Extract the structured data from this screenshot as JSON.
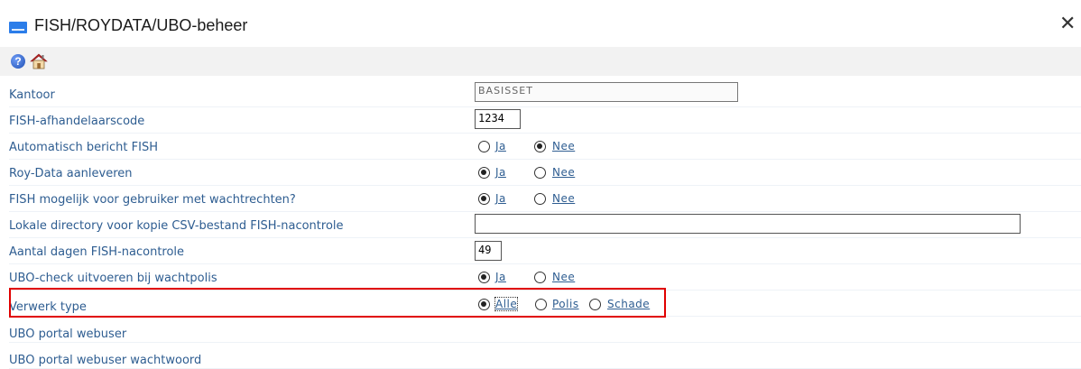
{
  "window": {
    "title": "FISH/ROYDATA/UBO-beheer",
    "close_glyph": "✕"
  },
  "toolbar": {
    "help_icon": "?",
    "icons": [
      "help-icon",
      "home-icon"
    ]
  },
  "rows": [
    {
      "label": "Kantoor",
      "value": "BASISSET"
    },
    {
      "label": "FISH-afhandelaarscode",
      "value": "1234"
    },
    {
      "label": "Automatisch bericht FISH",
      "options": [
        "Ja",
        "Nee"
      ],
      "selected": "Nee"
    },
    {
      "label": "Roy-Data aanleveren",
      "options": [
        "Ja",
        "Nee"
      ],
      "selected": "Ja"
    },
    {
      "label": "FISH mogelijk voor gebruiker met wachtrechten?",
      "options": [
        "Ja",
        "Nee"
      ],
      "selected": "Ja"
    },
    {
      "label": "Lokale directory voor kopie CSV-bestand FISH-nacontrole",
      "value": ""
    },
    {
      "label": "Aantal dagen FISH-nacontrole",
      "value": "49"
    },
    {
      "label": "UBO-check uitvoeren bij wachtpolis",
      "options": [
        "Ja",
        "Nee"
      ],
      "selected": "Ja"
    },
    {
      "label": "Verwerk type",
      "options": [
        "Alle",
        "Polis",
        "Schade"
      ],
      "selected": "Alle"
    },
    {
      "label": "UBO portal webuser"
    },
    {
      "label": "UBO portal webuser wachtwoord"
    }
  ],
  "colors": {
    "label": "#2e5d91",
    "highlight": "#e00000",
    "toolbar_bg": "#f2f2f2"
  }
}
